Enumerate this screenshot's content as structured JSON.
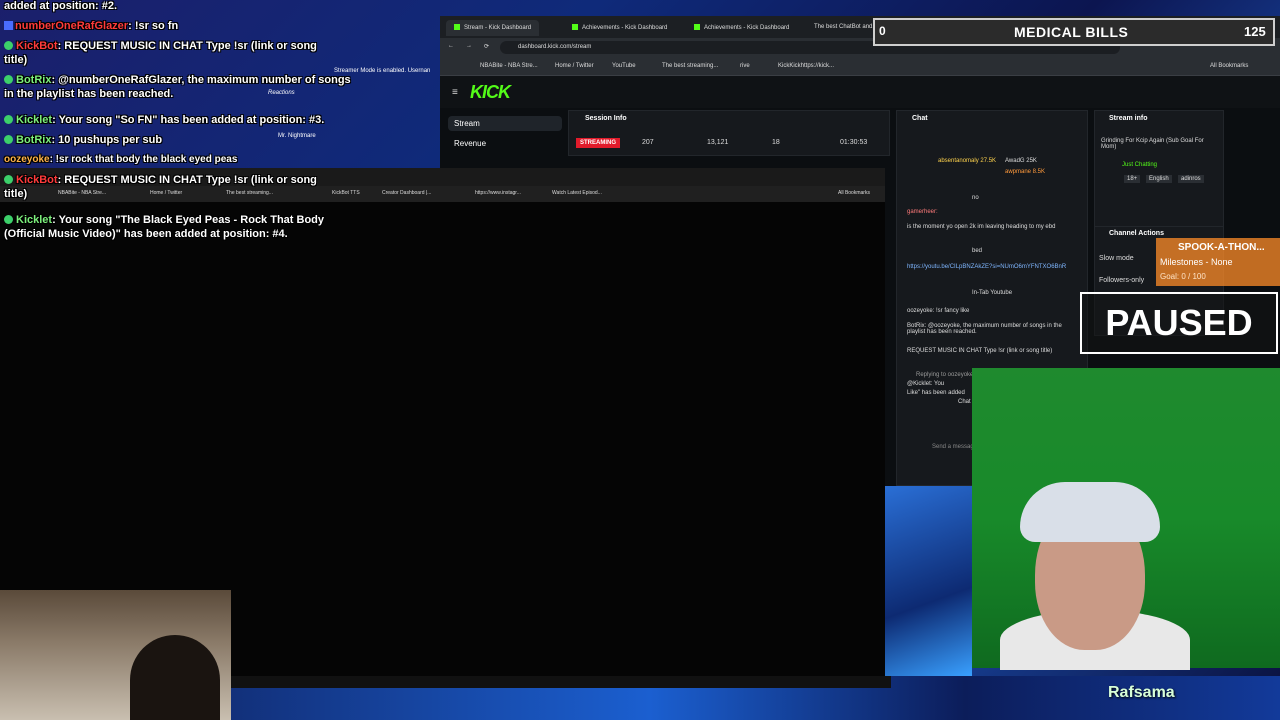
{
  "overlay": {
    "top_line": "added at position: #2.",
    "lines": [
      {
        "user": "numberOneRafGlazer",
        "text": ": !sr so fn"
      },
      {
        "user": "KickBot",
        "text": ": REQUEST MUSIC IN CHAT Type !sr (link or song"
      },
      {
        "user": "",
        "text": "title)"
      },
      {
        "user": "BotRix",
        "text": ": @numberOneRafGlazer, the maximum number of songs"
      },
      {
        "user": "",
        "text": "in the playlist has been reached."
      },
      {
        "user": "Kicklet",
        "text": ": Your song \"So FN\" has been added at position: #3."
      },
      {
        "user": "BotRix",
        "text": ": 10 pushups per sub"
      },
      {
        "user": "oozeyoke",
        "text": ": !sr rock that body the black eyed peas"
      },
      {
        "user": "KickBot",
        "text": ": REQUEST MUSIC IN CHAT Type !sr (link or song"
      },
      {
        "user": "",
        "text": "title)"
      },
      {
        "user": "Kicklet",
        "text": ": Your song \"The Black Eyed Peas - Rock That Body"
      },
      {
        "user": "",
        "text": "(Official Music Video)\" has been added at position: #4."
      }
    ]
  },
  "dark_browser": {
    "bookmarks": [
      "NBABite - NBA Stre...",
      "Home / Twitter",
      "The best streaming...",
      "KickBot TTS",
      "Creator Dashboard |...",
      "https://www.instagr...",
      "Watch Latest Episod...",
      "All Bookmarks"
    ]
  },
  "kick": {
    "tabs": [
      "Stream - Kick Dashboard",
      "Achievements - Kick Dashboard",
      "Achievements - Kick Dashboard",
      "The best ChatBot and..."
    ],
    "url": "dashboard.kick.com/stream",
    "bookmarks": [
      "NBABite - NBA Stre...",
      "Home / Twitter",
      "YouTube",
      "The best streaming...",
      "rive",
      "KickKickhttps://kick..."
    ],
    "all_bookmarks": "All Bookmarks",
    "logo": "KICK",
    "sidebar": [
      "Stream",
      "Revenue"
    ],
    "session": {
      "title": "Session Info",
      "status": "STREAMING",
      "viewers": "207",
      "followers": "13,121",
      "subs": "18",
      "duration": "01:30:53"
    },
    "chat": {
      "title": "Chat",
      "top_users": [
        "absentanomaly 27.5K",
        "AwadG 25K",
        "awpmane 8.5K"
      ],
      "messages": [
        "no",
        "gamerheer:",
        "is the moment yo open 2k im leaving heading to my ebd",
        "bed",
        "https://youtu.be/CILpBNZAkZE?si=NUmO6mYFNTXO6BnR",
        "In-Tab Youtube",
        "oozeyoke: !sr fancy like",
        "BotRix: @oozeyoke, the maximum number of songs in the playlist has been reached.",
        "REQUEST MUSIC IN CHAT Type !sr (link or song title)",
        "Replying to oozeyoke",
        "@Kicklet: You",
        "Like\" has been added",
        "Chat",
        "Send a message"
      ]
    },
    "stream_info": {
      "title": "Stream info",
      "stream_title": "Grinding For Kcip Again (Sub Goal For Mom)",
      "category": "Just Chatting",
      "tags": [
        "18+",
        "English",
        "adinros"
      ]
    },
    "channel_actions": {
      "title": "Channel Actions",
      "items": [
        "Slow mode",
        "Followers-only"
      ]
    }
  },
  "medical_bills": {
    "label": "MEDICAL BILLS",
    "left_value": "0",
    "right_value": "125"
  },
  "spook": {
    "title": "SPOOK-A-THON...",
    "milestones": "Milestones - None",
    "goal": "Goal: 0 / 100"
  },
  "paused": "PAUSED",
  "brand": "Rafsama",
  "mr_nightmare": "Mr. Nightmare",
  "streamer_mode": "Streamer Mode is enabled. Usernan",
  "reactions": "Reactions",
  "colors": {
    "kick_green": "#53fc18",
    "streaming_red": "#e11b2b"
  }
}
